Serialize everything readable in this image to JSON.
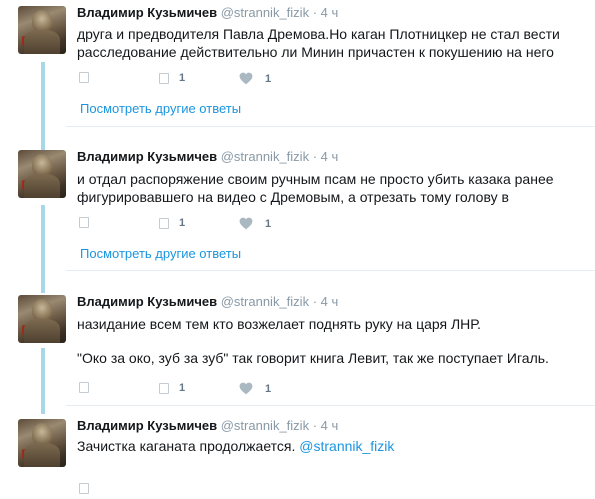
{
  "tweets": [
    {
      "name": "Владимир Кузьмичев",
      "handle": "@strannik_fizik",
      "dot": "·",
      "time": "4 ч",
      "lines": [
        "друга и предводителя Павла  Дремова.Но каган Плотницкер не стал  вести",
        "расследование действительно ли Минин причастен к покушению на  него"
      ],
      "retweets": "1",
      "likes": "1",
      "more_replies": "Посмотреть другие ответы"
    },
    {
      "name": "Владимир Кузьмичев",
      "handle": "@strannik_fizik",
      "dot": "·",
      "time": "4 ч",
      "lines": [
        "и  отдал распоряжение своим ручным  псам не просто убить казака   ранее",
        "фигурировавшего на видео с Дремовым, а  отрезать тому голову в"
      ],
      "retweets": "1",
      "likes": "1",
      "more_replies": "Посмотреть другие ответы"
    },
    {
      "name": "Владимир Кузьмичев",
      "handle": "@strannik_fizik",
      "dot": "·",
      "time": "4 ч",
      "lines": [
        "назидание  всем тем кто возжелает поднять руку на  царя ЛНР.",
        "",
        "\"Око   за око, зуб за зуб\" так говорит книга Левит, так же поступает Игаль."
      ],
      "retweets": "1",
      "likes": "1"
    },
    {
      "name": "Владимир Кузьмичев",
      "handle": "@strannik_fizik",
      "dot": "·",
      "time": "4 ч",
      "text_before_mention": "Зачистка каганата продолжается. ",
      "mention": "@strannik_fizik"
    }
  ],
  "icons": {
    "reply": "reply-icon",
    "retweet": "retweet-icon",
    "like": "heart-icon",
    "avatar": "avatar-image"
  },
  "colors": {
    "link": "#1b95e0",
    "thread_line": "#a8d7e8",
    "secondary_text": "#8899a6",
    "like_heart": "#aab8c2"
  }
}
